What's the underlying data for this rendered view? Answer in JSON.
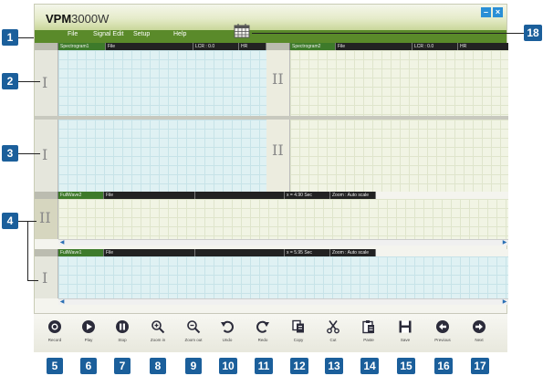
{
  "app": {
    "title_bold": "VPM",
    "title_rest": "3000W"
  },
  "window_controls": {
    "minimize": "–",
    "close": "×"
  },
  "menu": [
    "File",
    "Signal Edit",
    "Setup",
    "Help"
  ],
  "spectrogram1": {
    "name": "Spectrogram1",
    "file": "File",
    "lcr": "LCR : 0.0",
    "hr": "HR"
  },
  "spectrogram2": {
    "name": "Spectrogram2",
    "file": "File",
    "lcr": "LCR : 0.0",
    "hr": "HR"
  },
  "roman": {
    "one": "I",
    "two": "II"
  },
  "fullwave2": {
    "name": "FullWave2",
    "file": "File",
    "x": "x = 4.90 Sec",
    "zoom": "Zoom : Auto scale"
  },
  "fullwave1": {
    "name": "FullWave1",
    "file": "File",
    "x": "x = 5.95 Sec",
    "zoom": "Zoom : Auto scale"
  },
  "toolbar": [
    "Record",
    "Play",
    "Stop",
    "Zoom in",
    "Zoom out",
    "Undo",
    "Redo",
    "Copy",
    "Cut",
    "Paste",
    "Save",
    "Previous",
    "Next"
  ],
  "callouts": [
    "1",
    "2",
    "3",
    "4",
    "5",
    "6",
    "7",
    "8",
    "9",
    "10",
    "11",
    "12",
    "13",
    "14",
    "15",
    "16",
    "17",
    "18"
  ],
  "colors": {
    "badge": "#1b5f9b",
    "menubar": "#5a8a2a",
    "plot_blue": "#dff1f3",
    "plot_green": "#f1f4e4"
  },
  "icons": [
    "record-icon",
    "play-icon",
    "stop-icon",
    "zoom-in-icon",
    "zoom-out-icon",
    "undo-icon",
    "redo-icon",
    "copy-icon",
    "cut-icon",
    "paste-icon",
    "save-icon",
    "previous-icon",
    "next-icon",
    "calendar-icon"
  ]
}
